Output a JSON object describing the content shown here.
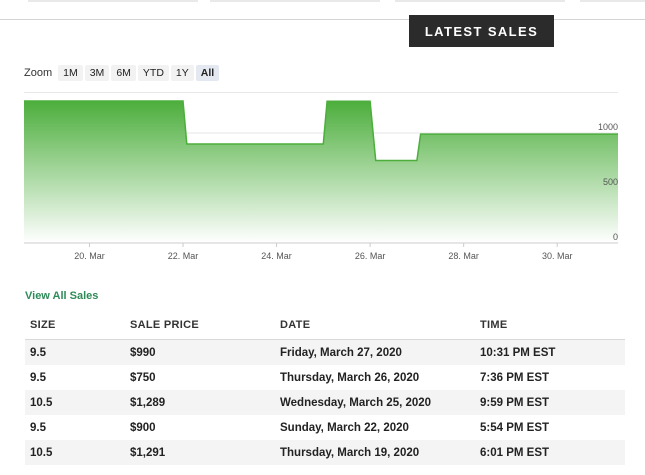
{
  "header": {
    "latest_sales_label": "LATEST SALES"
  },
  "zoom": {
    "label": "Zoom",
    "options": [
      "1M",
      "3M",
      "6M",
      "YTD",
      "1Y",
      "All"
    ],
    "selected": "All"
  },
  "chart_data": {
    "type": "area",
    "x": [
      "19. Mar",
      "21. Mar",
      "22. Mar",
      "22. Mar",
      "25. Mar",
      "25. Mar",
      "26. Mar",
      "26. Mar",
      "27. Mar",
      "27. Mar",
      "31. Mar"
    ],
    "series": [
      {
        "values": [
          1291,
          1291,
          1291,
          900,
          900,
          1289,
          1289,
          750,
          750,
          990,
          990
        ]
      }
    ],
    "x_tick_labels": [
      "20. Mar",
      "22. Mar",
      "24. Mar",
      "26. Mar",
      "28. Mar",
      "30. Mar"
    ],
    "y_tick_labels": [
      "0",
      "500",
      "1000"
    ],
    "ylim": [
      0,
      1300
    ],
    "grid": true,
    "colors": {
      "line": "#4cae3c",
      "fill_top": "#4cae3c",
      "fill_bottom": "#ffffff"
    }
  },
  "view_all_label": "View All Sales",
  "table": {
    "headers": {
      "size": "SIZE",
      "price": "SALE PRICE",
      "date": "DATE",
      "time": "TIME"
    },
    "rows": [
      {
        "size": "9.5",
        "price": "$990",
        "date": "Friday, March 27, 2020",
        "time": "10:31 PM EST"
      },
      {
        "size": "9.5",
        "price": "$750",
        "date": "Thursday, March 26, 2020",
        "time": "7:36 PM EST"
      },
      {
        "size": "10.5",
        "price": "$1,289",
        "date": "Wednesday, March 25, 2020",
        "time": "9:59 PM EST"
      },
      {
        "size": "9.5",
        "price": "$900",
        "date": "Sunday, March 22, 2020",
        "time": "5:54 PM EST"
      },
      {
        "size": "10.5",
        "price": "$1,291",
        "date": "Thursday, March 19, 2020",
        "time": "6:01 PM EST"
      }
    ]
  }
}
